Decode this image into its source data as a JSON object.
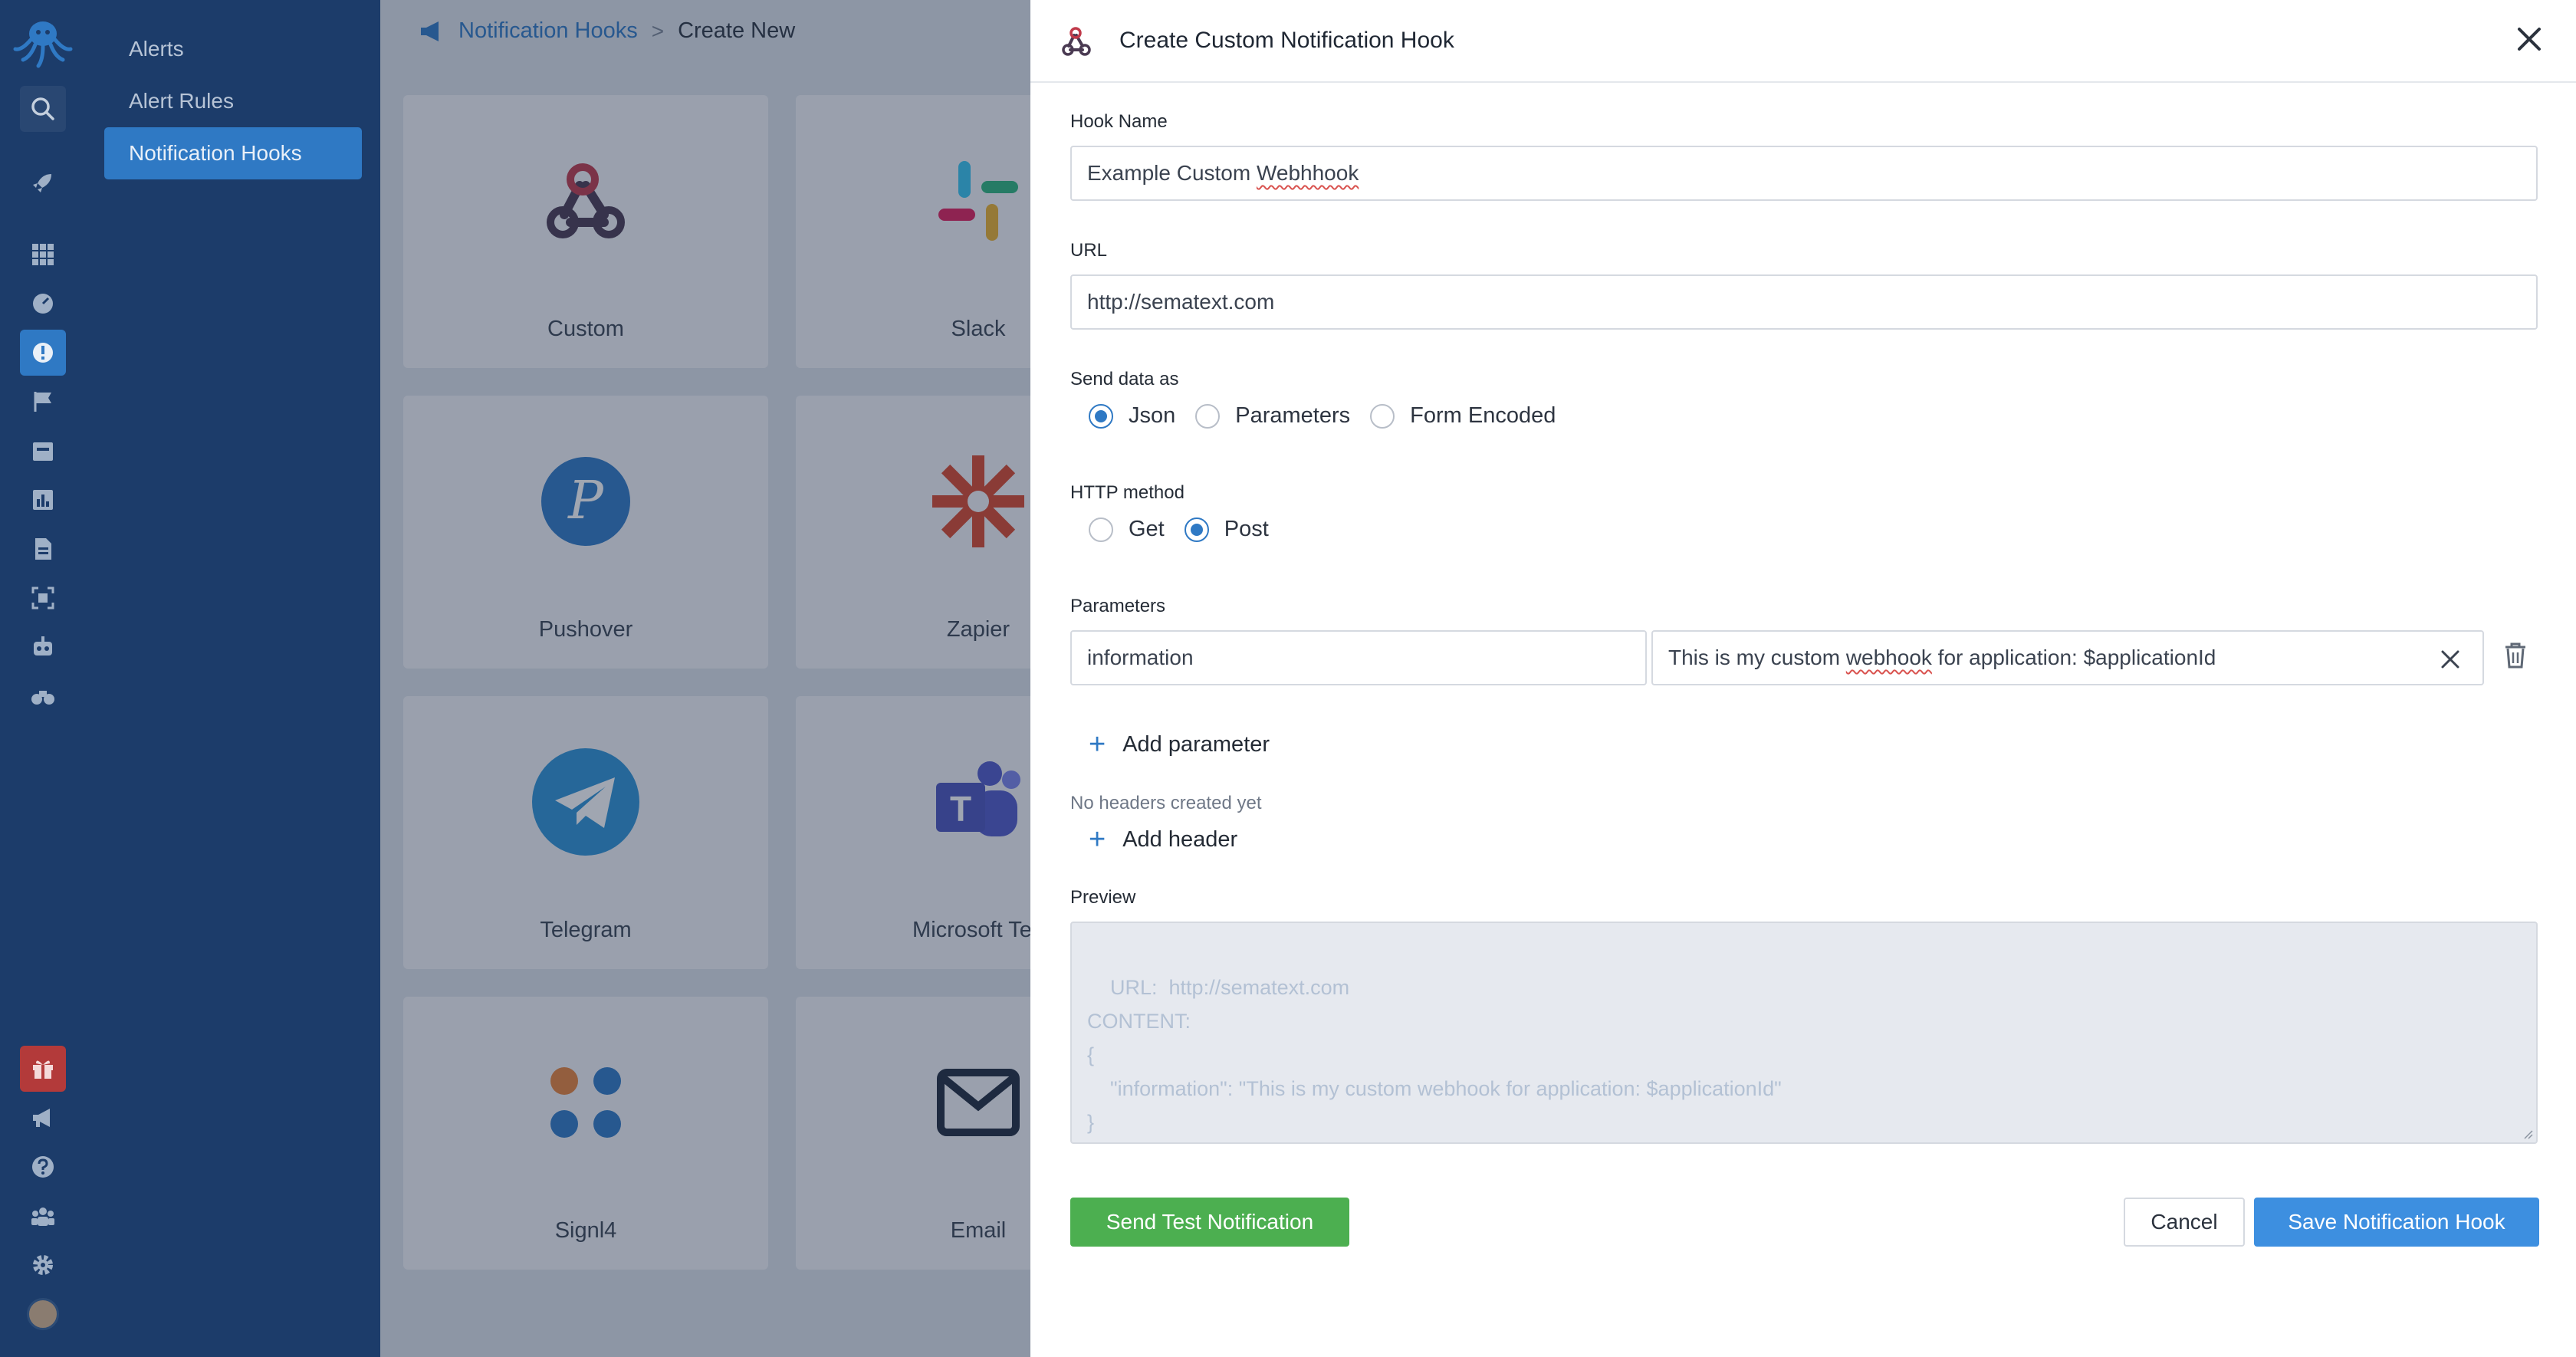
{
  "sidebar": {
    "items": [
      {
        "label": "Alerts"
      },
      {
        "label": "Alert Rules"
      },
      {
        "label": "Notification Hooks"
      }
    ]
  },
  "breadcrumb": {
    "parent": "Notification Hooks",
    "separator": ">",
    "current": "Create New"
  },
  "tiles": [
    {
      "label": "Custom"
    },
    {
      "label": "Slack"
    },
    {
      "label": "Pushover"
    },
    {
      "label": "Zapier"
    },
    {
      "label": "Telegram"
    },
    {
      "label": "Microsoft Tea"
    },
    {
      "label": "Signl4"
    },
    {
      "label": "Email"
    }
  ],
  "drawer": {
    "title": "Create Custom Notification Hook",
    "hook_name": {
      "label": "Hook Name",
      "value_prefix": "Example Custom ",
      "value_misspelled": "Webhhook"
    },
    "url": {
      "label": "URL",
      "value": "http://sematext.com"
    },
    "send_data": {
      "label": "Send data as",
      "options": [
        "Json",
        "Parameters",
        "Form Encoded"
      ],
      "selected": "Json"
    },
    "http_method": {
      "label": "HTTP method",
      "options": [
        "Get",
        "Post"
      ],
      "selected": "Post"
    },
    "parameters": {
      "label": "Parameters",
      "rows": [
        {
          "key": "information",
          "value_pre": "This is my custom ",
          "value_flag": "webhook",
          "value_post": " for application: $applicationId"
        }
      ],
      "add_label": "Add parameter"
    },
    "headers": {
      "empty_text": "No headers created yet",
      "add_label": "Add header"
    },
    "preview": {
      "label": "Preview",
      "text": "URL:  http://sematext.com\nCONTENT:\n{\n    \"information\": \"This is my custom webhook for application: $applicationId\"\n}"
    },
    "buttons": {
      "test": "Send Test Notification",
      "cancel": "Cancel",
      "save": "Save Notification Hook"
    }
  },
  "colors": {
    "primary": "#2f79c4",
    "sidebar": "#1c3c6a",
    "success": "#4caf50",
    "save": "#3d8fe0"
  }
}
